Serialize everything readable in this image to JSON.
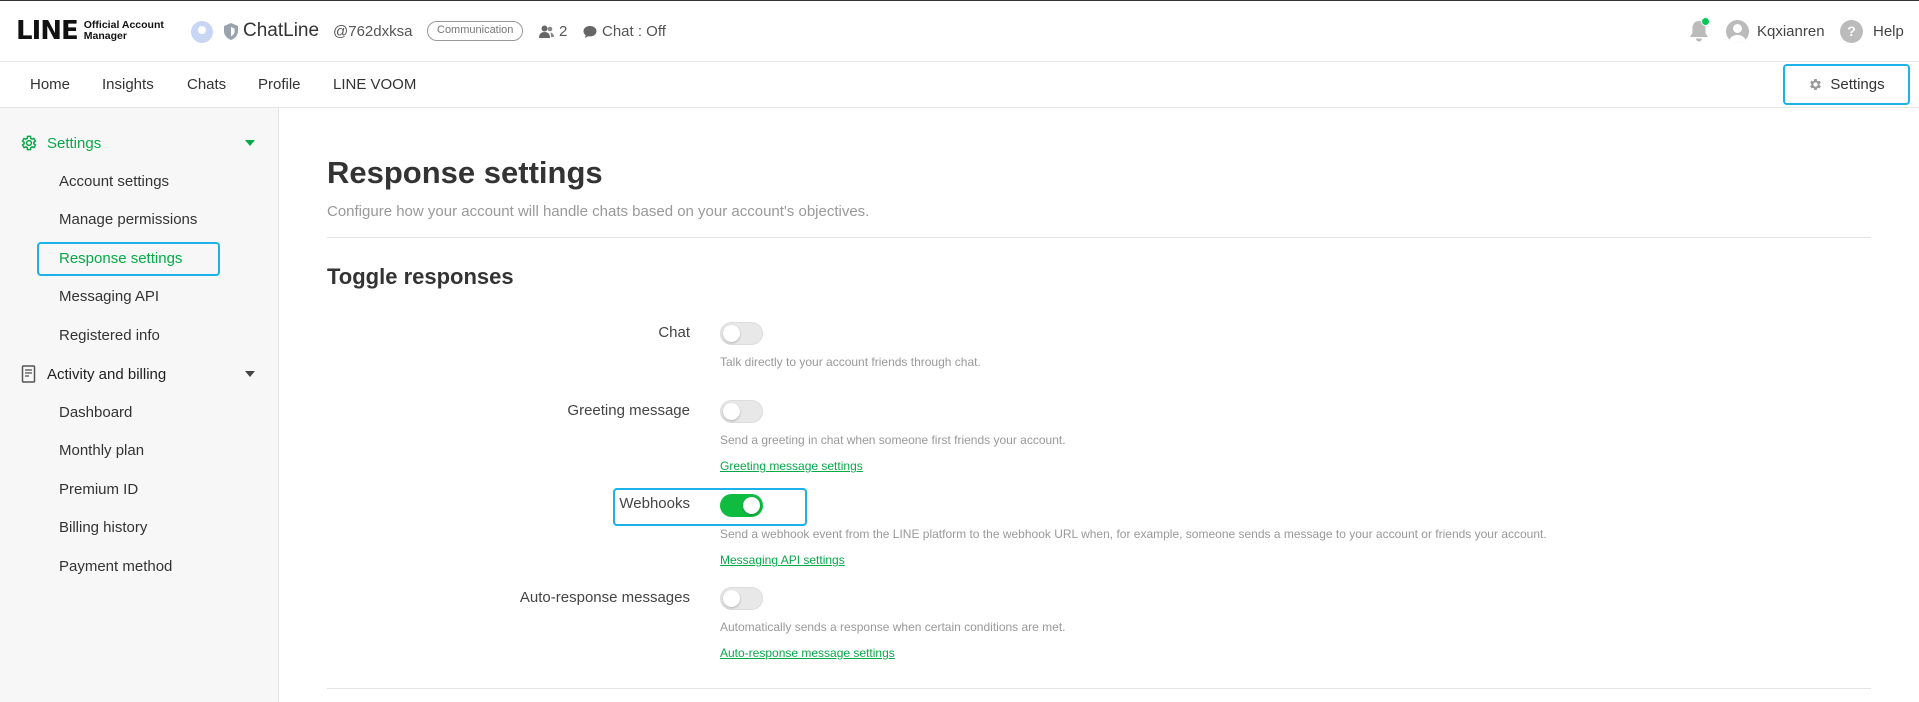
{
  "header": {
    "logo_main": "LINE",
    "logo_sub": "Official Account Manager",
    "account_name": "ChatLine",
    "account_id": "@762dxksa",
    "category_badge": "Communication",
    "friends_count": "2",
    "chat_status": "Chat : Off",
    "user_name": "Kqxianren",
    "help_label": "Help",
    "notification_dot_color": "#06c755"
  },
  "nav": {
    "items": [
      {
        "label": "Home"
      },
      {
        "label": "Insights"
      },
      {
        "label": "Chats"
      },
      {
        "label": "Profile"
      },
      {
        "label": "LINE VOOM"
      }
    ],
    "settings_label": "Settings"
  },
  "sidebar": {
    "settings_section": {
      "label": "Settings",
      "items": [
        {
          "label": "Account settings"
        },
        {
          "label": "Manage permissions"
        },
        {
          "label": "Response settings",
          "active": true
        },
        {
          "label": "Messaging API"
        },
        {
          "label": "Registered info"
        }
      ]
    },
    "billing_section": {
      "label": "Activity and billing",
      "items": [
        {
          "label": "Dashboard"
        },
        {
          "label": "Monthly plan"
        },
        {
          "label": "Premium ID"
        },
        {
          "label": "Billing history"
        },
        {
          "label": "Payment method"
        }
      ]
    }
  },
  "main": {
    "title": "Response settings",
    "description": "Configure how your account will handle chats based on your account's objectives.",
    "section_title": "Toggle responses",
    "rows": [
      {
        "label": "Chat",
        "enabled": false,
        "help": "Talk directly to your account friends through chat.",
        "link": ""
      },
      {
        "label": "Greeting message",
        "enabled": false,
        "help": "Send a greeting in chat when someone first friends your account.",
        "link": "Greeting message settings"
      },
      {
        "label": "Webhooks",
        "enabled": true,
        "help": "Send a webhook event from the LINE platform to the webhook URL when, for example, someone sends a message to your account or friends your account.",
        "link": "Messaging API settings"
      },
      {
        "label": "Auto-response messages",
        "enabled": false,
        "help": "Automatically sends a response when certain conditions are met.",
        "link": "Auto-response message settings"
      }
    ]
  },
  "colors": {
    "accent_green": "#06a948",
    "toggle_on": "#0fbc40",
    "highlight_blue": "#1cb1e8"
  }
}
